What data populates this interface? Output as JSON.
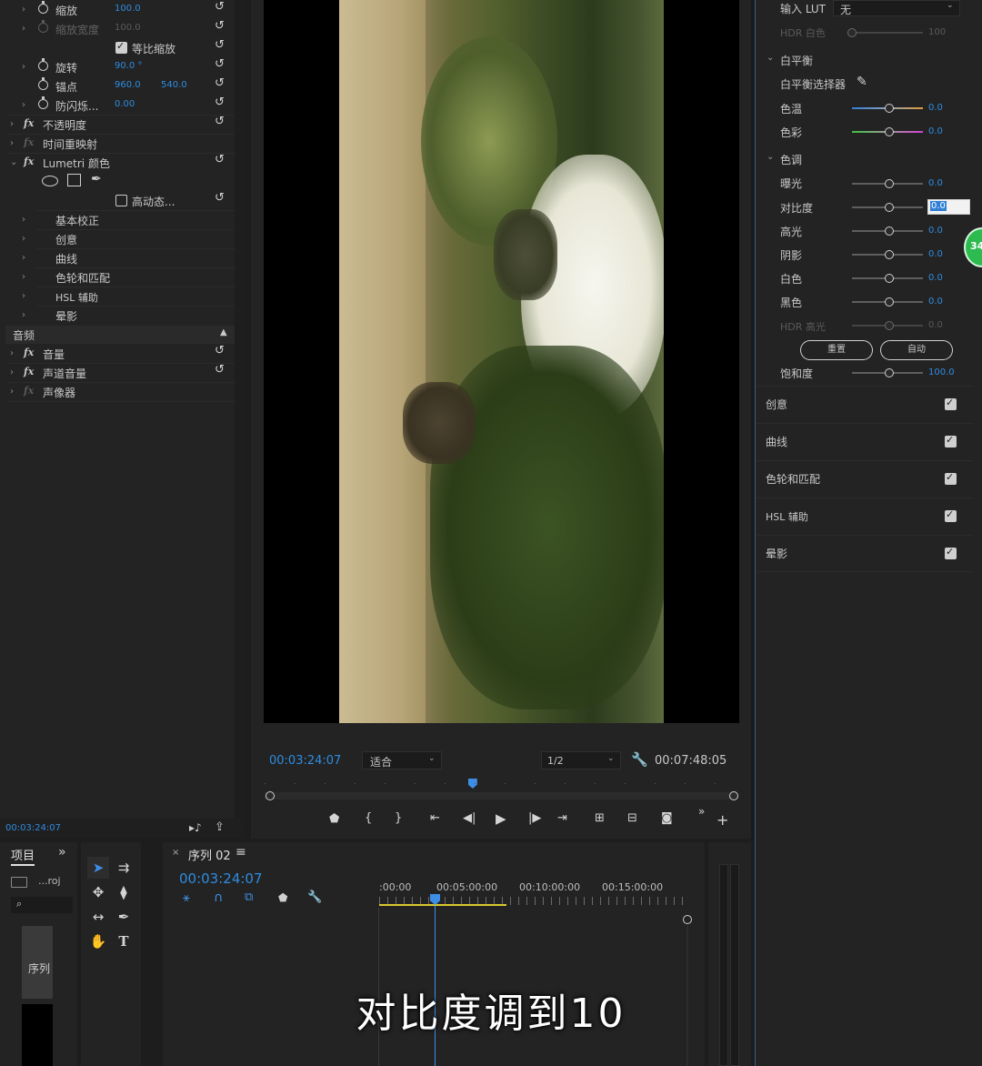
{
  "effect_controls": {
    "rows": [
      {
        "label": "缩放",
        "value": "100.0"
      },
      {
        "label": "缩放宽度",
        "value": "100.0"
      },
      {
        "label": "等比缩放"
      },
      {
        "label": "旋转",
        "value": "90.0 °"
      },
      {
        "label": "锚点",
        "value": "960.0",
        "value2": "540.0"
      },
      {
        "label": "防闪烁...",
        "value": "0.00"
      },
      {
        "label": "不透明度"
      },
      {
        "label": "时间重映射"
      },
      {
        "label": "Lumetri 颜色"
      },
      {
        "label": "高动态..."
      },
      {
        "label": "基本校正"
      },
      {
        "label": "创意"
      },
      {
        "label": "曲线"
      },
      {
        "label": "色轮和匹配"
      },
      {
        "label": "HSL 辅助"
      },
      {
        "label": "晕影"
      }
    ],
    "audio_header": "音频",
    "audio_rows": [
      {
        "label": "音量"
      },
      {
        "label": "声道音量"
      },
      {
        "label": "声像器"
      }
    ],
    "timecode": "00:03:24:07"
  },
  "program_monitor": {
    "timecode": "00:03:24:07",
    "zoom": "适合",
    "resolution": "1/2",
    "duration": "00:07:48:05",
    "playhead_fraction": 0.44
  },
  "lumetri": {
    "input_lut_label": "输入 LUT",
    "input_lut_value": "无",
    "hdr_white_label": "HDR 白色",
    "hdr_white_value": "100",
    "white_balance_header": "白平衡",
    "wb_selector_label": "白平衡选择器",
    "temp_label": "色温",
    "temp_value": "0.0",
    "tint_label": "色彩",
    "tint_value": "0.0",
    "tone_header": "色调",
    "tone": [
      {
        "label": "曝光",
        "value": "0.0"
      },
      {
        "label": "对比度",
        "value": "0.0"
      },
      {
        "label": "高光",
        "value": "0.0"
      },
      {
        "label": "阴影",
        "value": "0.0"
      },
      {
        "label": "白色",
        "value": "0.0"
      },
      {
        "label": "黑色",
        "value": "0.0"
      },
      {
        "label": "HDR 高光",
        "value": "0.0"
      }
    ],
    "reset_button": "重置",
    "auto_button": "自动",
    "saturation_label": "饱和度",
    "saturation_value": "100.0",
    "sections": [
      "创意",
      "曲线",
      "色轮和匹配",
      "HSL 辅助",
      "晕影"
    ],
    "badge": "34"
  },
  "project": {
    "tab": "项目",
    "project_name": "...roj",
    "sequence_label": "序列"
  },
  "timeline": {
    "tab": "序列 02",
    "timecode": "00:03:24:07",
    "ruler": [
      ":00:00",
      "00:05:00:00",
      "00:10:00:00",
      "00:15:00:00"
    ]
  },
  "subtitle": "对比度调到10",
  "colors": {
    "accent": "#2f8ce0",
    "background": "#1d1d1d",
    "panel": "#232323"
  }
}
